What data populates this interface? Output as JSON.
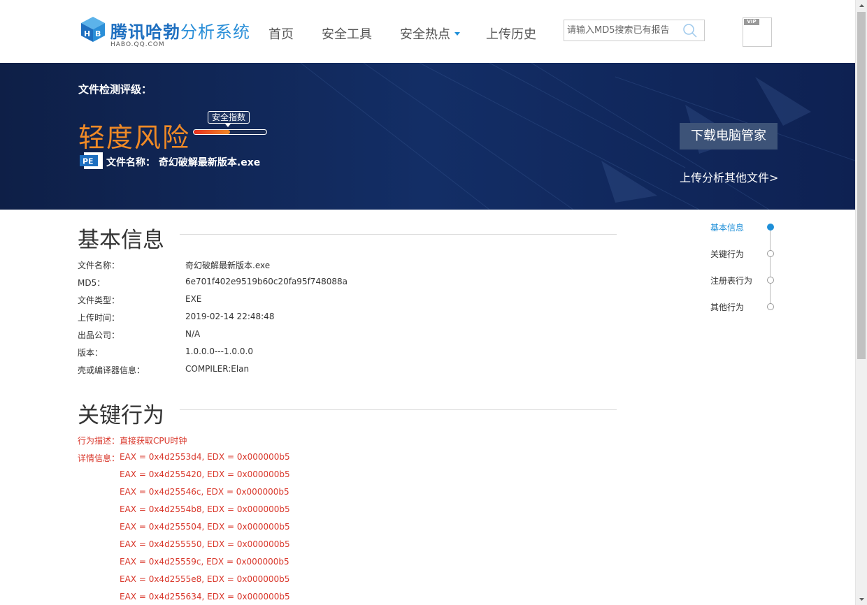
{
  "header": {
    "logo_title_primary": "腾讯哈勃",
    "logo_title_secondary": "分析系统",
    "logo_subtitle": "HABO.QQ.COM",
    "nav": [
      "首页",
      "安全工具",
      "安全热点",
      "上传历史"
    ],
    "search_placeholder": "请输入MD5搜索已有报告",
    "vip_label": "VIP"
  },
  "banner": {
    "grade_label": "文件检测评级：",
    "risk_level": "轻度风险",
    "index_label": "安全指数",
    "index_fraction": 0.5,
    "file_icon_label": "PE",
    "file_name_label": "文件名称：",
    "file_name": "奇幻破解最新版本.exe",
    "download_button": "下载电脑管家",
    "upload_other": "上传分析其他文件>"
  },
  "basic_info": {
    "title": "基本信息",
    "rows": [
      {
        "key": "文件名称：",
        "value": "奇幻破解最新版本.exe"
      },
      {
        "key": "MD5：",
        "value": "6e701f402e9519b60c20fa95f748088a"
      },
      {
        "key": "文件类型：",
        "value": "EXE"
      },
      {
        "key": "上传时间：",
        "value": "2019-02-14 22:48:48"
      },
      {
        "key": "出品公司：",
        "value": "N/A"
      },
      {
        "key": "版本：",
        "value": "1.0.0.0---1.0.0.0"
      },
      {
        "key": "壳或编译器信息：",
        "value": "COMPILER:Elan"
      }
    ]
  },
  "key_behavior": {
    "title": "关键行为",
    "description_label": "行为描述：",
    "description": "直接获取CPU时钟",
    "detail_label": "详情信息：",
    "details": [
      "EAX = 0x4d2553d4, EDX = 0x000000b5",
      "EAX = 0x4d255420, EDX = 0x000000b5",
      "EAX = 0x4d25546c, EDX = 0x000000b5",
      "EAX = 0x4d2554b8, EDX = 0x000000b5",
      "EAX = 0x4d255504, EDX = 0x000000b5",
      "EAX = 0x4d255550, EDX = 0x000000b5",
      "EAX = 0x4d25559c, EDX = 0x000000b5",
      "EAX = 0x4d2555e8, EDX = 0x000000b5",
      "EAX = 0x4d255634, EDX = 0x000000b5"
    ]
  },
  "side_nav": {
    "items": [
      "基本信息",
      "关键行为",
      "注册表行为",
      "其他行为"
    ],
    "active": 0
  },
  "colors": {
    "brand_blue": "#1e6fc0",
    "risk_orange": "#f08a26",
    "alert_red": "#d9372b",
    "banner_navy": "#132e66"
  }
}
